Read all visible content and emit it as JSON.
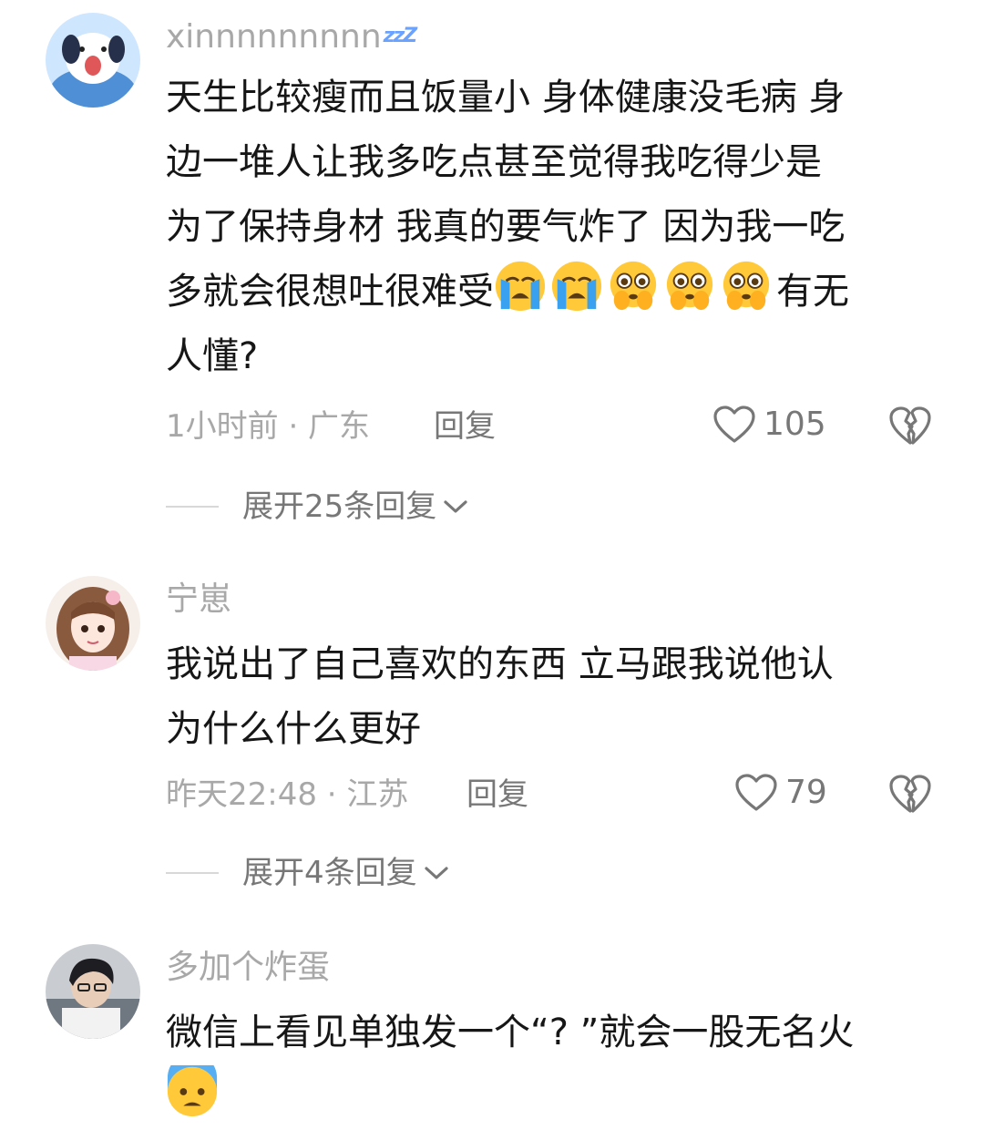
{
  "comments": [
    {
      "username": "xinnnnnnnnn",
      "username_decoration": "zzZ",
      "avatar_icon": "cartoon-dog-avatar",
      "lines": [
        "天生比较瘦而且饭量小 身体健康没毛病 身",
        "边一堆人让我多吃点甚至觉得我吃得少是",
        "为了保持身材 我真的要气炸了 因为我一吃",
        "多就会很想吐很难受",
        "有无",
        "人懂?"
      ],
      "emojis": [
        "loudly-crying-face",
        "loudly-crying-face",
        "pleading-face",
        "pleading-face",
        "pleading-face"
      ],
      "time_location": "1小时前 · 广东",
      "reply_label": "回复",
      "likes": "105",
      "expand_label": "展开25条回复"
    },
    {
      "username": "宁崽",
      "avatar_icon": "anime-girl-avatar",
      "lines": [
        "我说出了自己喜欢的东西 立马跟我说他认",
        "为什么什么更好"
      ],
      "time_location": "昨天22:48 · 江苏",
      "reply_label": "回复",
      "likes": "79",
      "expand_label": "展开4条回复"
    },
    {
      "username": "多加个炸蛋",
      "avatar_icon": "boy-avatar",
      "lines": [
        "微信上看见单独发一个“? ”就会一股无名火"
      ],
      "emojis": [
        "anxious-face-with-sweat"
      ]
    }
  ],
  "colors": {
    "background": "#ffffff",
    "text": "#161616",
    "muted": "#a8a8a8",
    "secondary": "#777777",
    "emoji_yellow": "#ffc93a",
    "emoji_blue": "#3aa0f0"
  }
}
